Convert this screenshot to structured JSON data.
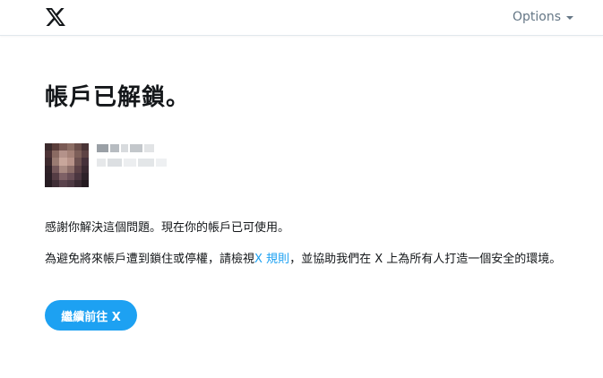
{
  "header": {
    "logo_icon": "x-logo-icon",
    "options_label": "Options"
  },
  "main": {
    "title": "帳戶已解鎖。",
    "message1": "感謝你解決這個問題。現在你的帳戶已可使用。",
    "message2_before": "為避免將來帳戶遭到鎖住或停權，請檢視",
    "rules_link": "X 規則",
    "message2_after": "，並協助我們在 X 上為所有人打造一個安全的環境。",
    "continue_button": "繼續前往 X"
  },
  "colors": {
    "accent": "#1da1f2",
    "text": "#14171a",
    "muted": "#657786"
  }
}
